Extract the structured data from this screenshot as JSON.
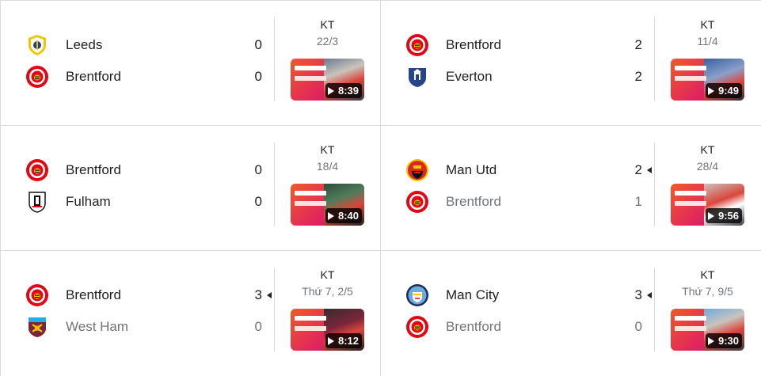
{
  "matches": [
    {
      "home": {
        "name": "Leeds",
        "score": "0",
        "crest": "leeds-crest-icon"
      },
      "away": {
        "name": "Brentford",
        "score": "0",
        "crest": "brentford-crest-icon"
      },
      "status": "KT",
      "date": "22/3",
      "duration": "8:39",
      "winner": "none"
    },
    {
      "home": {
        "name": "Brentford",
        "score": "2",
        "crest": "brentford-crest-icon"
      },
      "away": {
        "name": "Everton",
        "score": "2",
        "crest": "everton-crest-icon"
      },
      "status": "KT",
      "date": "11/4",
      "duration": "9:49",
      "winner": "none"
    },
    {
      "home": {
        "name": "Brentford",
        "score": "0",
        "crest": "brentford-crest-icon"
      },
      "away": {
        "name": "Fulham",
        "score": "0",
        "crest": "fulham-crest-icon"
      },
      "status": "KT",
      "date": "18/4",
      "duration": "8:40",
      "winner": "none"
    },
    {
      "home": {
        "name": "Man Utd",
        "score": "2",
        "crest": "man-utd-crest-icon"
      },
      "away": {
        "name": "Brentford",
        "score": "1",
        "crest": "brentford-crest-icon"
      },
      "status": "KT",
      "date": "28/4",
      "duration": "9:56",
      "winner": "home"
    },
    {
      "home": {
        "name": "Brentford",
        "score": "3",
        "crest": "brentford-crest-icon"
      },
      "away": {
        "name": "West Ham",
        "score": "0",
        "crest": "west-ham-crest-icon"
      },
      "status": "KT",
      "date": "Thứ 7, 2/5",
      "duration": "8:12",
      "winner": "home"
    },
    {
      "home": {
        "name": "Man City",
        "score": "3",
        "crest": "man-city-crest-icon"
      },
      "away": {
        "name": "Brentford",
        "score": "0",
        "crest": "brentford-crest-icon"
      },
      "status": "KT",
      "date": "Thứ 7, 9/5",
      "duration": "9:30",
      "winner": "home"
    }
  ],
  "colors": {
    "brentford_red": "#e30613",
    "leeds_yellow": "#f5c400",
    "leeds_blue": "#1d428a",
    "everton_blue": "#274488",
    "man_utd_red": "#da291c",
    "man_city_blue": "#6cabdd",
    "west_ham_claret": "#7a263a",
    "divider": "#dadce0",
    "muted_text": "#70757a"
  }
}
